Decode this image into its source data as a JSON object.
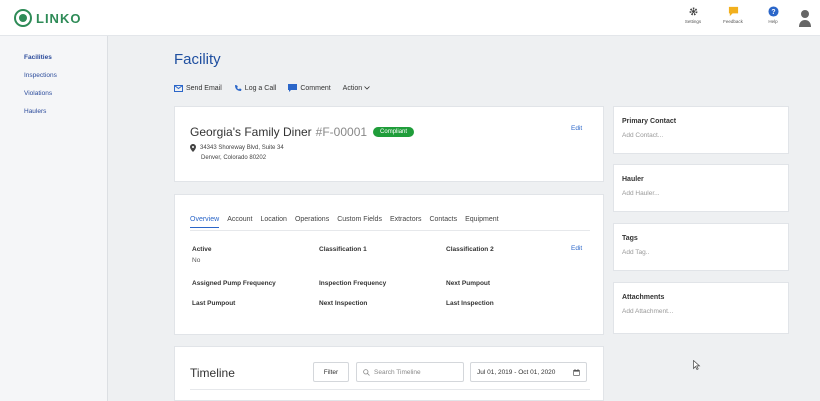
{
  "app": {
    "name": "LINKO",
    "brand_color": "#2e8b57",
    "accent": "#2b66c9"
  },
  "topbar": {
    "icons": [
      {
        "icon": "gear-icon",
        "label": "Settings"
      },
      {
        "icon": "feedback-icon",
        "label": "Feedback"
      },
      {
        "icon": "help-icon",
        "label": "Help"
      }
    ],
    "avatar": "user-avatar-icon"
  },
  "sidebar": {
    "items": [
      {
        "label": "Facilities",
        "active": true
      },
      {
        "label": "Inspections"
      },
      {
        "label": "Violations"
      },
      {
        "label": "Haulers"
      }
    ]
  },
  "page": {
    "title": "Facility"
  },
  "actions": {
    "send_email": "Send Email",
    "log_call": "Log a Call",
    "comment": "Comment",
    "action": "Action"
  },
  "facility": {
    "name": "Georgia's Family Diner",
    "id": "#F-00001",
    "status": "Compliant",
    "address_line1": "34343 Shoreway Blvd, Suite 34",
    "address_line2": "Denver, Colorado 80202",
    "edit": "Edit"
  },
  "tabs": [
    "Overview",
    "Account",
    "Location",
    "Operations",
    "Custom Fields",
    "Extractors",
    "Contacts",
    "Equipment"
  ],
  "details": {
    "edit": "Edit",
    "active_label": "Active",
    "active_value": "No",
    "classification1": "Classification 1",
    "classification2": "Classification 2",
    "assigned_pump_frequency": "Assigned Pump Frequency",
    "inspection_frequency": "Inspection Frequency",
    "next_pumpout": "Next Pumpout",
    "last_pumpout": "Last Pumpout",
    "next_inspection": "Next Inspection",
    "last_inspection": "Last Inspection"
  },
  "timeline": {
    "title": "Timeline",
    "filter": "Filter",
    "search_placeholder": "Search Timeline",
    "date_range": "Jul 01, 2019 - Oct 01, 2020"
  },
  "side_cards": {
    "primary_contact": {
      "title": "Primary Contact",
      "add": "Add Contact..."
    },
    "hauler": {
      "title": "Hauler",
      "add": "Add Hauler..."
    },
    "tags": {
      "title": "Tags",
      "add": "Add Tag.."
    },
    "attachments": {
      "title": "Attachments",
      "add": "Add Attachment..."
    }
  }
}
